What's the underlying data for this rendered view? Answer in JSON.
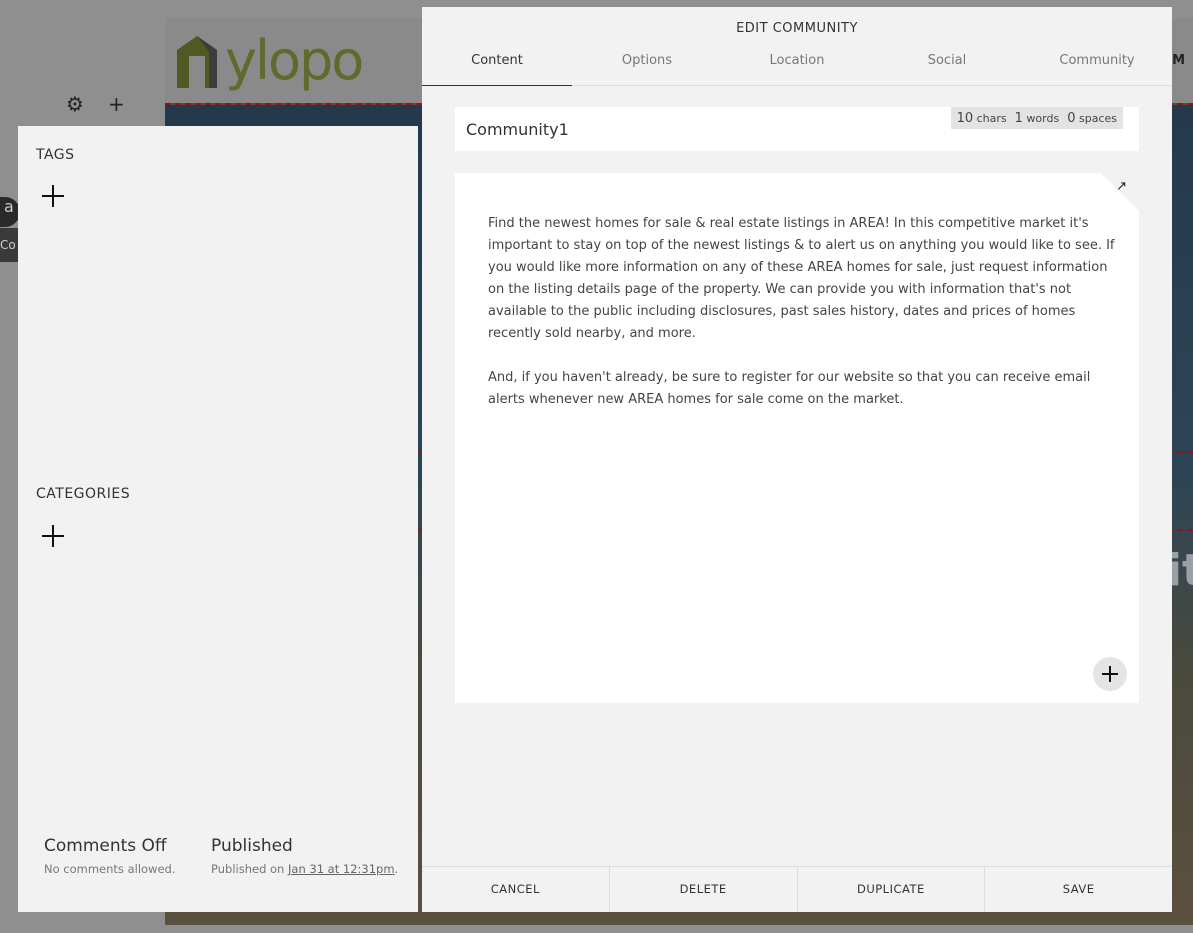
{
  "background": {
    "logo_text": "ylopo",
    "nav_fragment": "M",
    "hero_fragment": "it",
    "avatar_letter": "a",
    "avatar_sub": "Co"
  },
  "left_panel": {
    "tags_title": "TAGS",
    "categories_title": "CATEGORIES",
    "comments": {
      "title": "Comments Off",
      "subtitle": "No comments allowed."
    },
    "published": {
      "title": "Published",
      "prefix": "Published on ",
      "date": "Jan 31 at 12:31pm",
      "suffix": "."
    }
  },
  "modal": {
    "title": "EDIT COMMUNITY",
    "tabs": [
      {
        "label": "Content",
        "active": true
      },
      {
        "label": "Options"
      },
      {
        "label": "Location"
      },
      {
        "label": "Social"
      },
      {
        "label": "Community"
      }
    ],
    "title_field": {
      "value": "Community1"
    },
    "counter": {
      "chars_num": "10",
      "chars_label": "chars",
      "words_num": "1",
      "words_label": "words",
      "spaces_num": "0",
      "spaces_label": "spaces"
    },
    "body_paragraphs": [
      "Find the newest homes for sale & real estate listings in AREA!  In this competitive market it's important to stay on top of the newest listings & to alert us on anything you would like to see.  If you would like more information on any of these AREA  homes for sale, just request information on the listing details page of the property. We can provide you with information that's not available to the public including disclosures, past sales history, dates and prices of homes recently sold nearby, and more.",
      "And, if you haven't already, be sure to register for our website so that you can receive email alerts whenever new AREA homes for sale come on the market."
    ],
    "footer": {
      "cancel": "CANCEL",
      "delete": "DELETE",
      "duplicate": "DUPLICATE",
      "save": "SAVE"
    }
  }
}
